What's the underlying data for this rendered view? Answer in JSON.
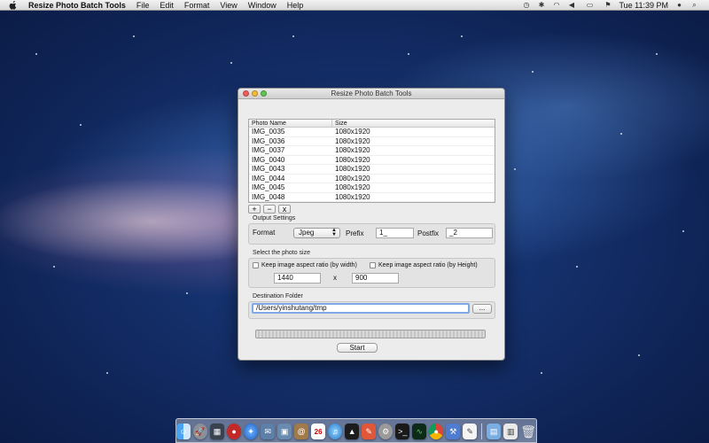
{
  "menubar": {
    "app_name": "Resize Photo Batch Tools",
    "items": [
      "File",
      "Edit",
      "Format",
      "View",
      "Window",
      "Help"
    ],
    "clock": "Tue 11:39 PM",
    "tray_icons": [
      "time-machine-icon",
      "bluetooth-icon",
      "wifi-icon",
      "volume-icon",
      "battery-icon",
      "flag-icon",
      "user-icon",
      "spotlight-icon"
    ]
  },
  "window": {
    "title": "Resize Photo Batch Tools",
    "table": {
      "columns": [
        "Photo Name",
        "Size"
      ],
      "rows": [
        [
          "IMG_0035",
          "1080x1920"
        ],
        [
          "IMG_0036",
          "1080x1920"
        ],
        [
          "IMG_0037",
          "1080x1920"
        ],
        [
          "IMG_0040",
          "1080x1920"
        ],
        [
          "IMG_0043",
          "1080x1920"
        ],
        [
          "IMG_0044",
          "1080x1920"
        ],
        [
          "IMG_0045",
          "1080x1920"
        ],
        [
          "IMG_0048",
          "1080x1920"
        ]
      ]
    },
    "table_buttons": {
      "add": "+",
      "remove": "−",
      "clear": "x"
    },
    "output_settings": {
      "label": "Output Settings",
      "format_label": "Format",
      "format_value": "Jpeg",
      "prefix_label": "Prefix",
      "prefix_value": "1_",
      "postfix_label": "Postfix",
      "postfix_value": "_2"
    },
    "photo_size": {
      "label": "Select the photo size",
      "by_width_label": "Keep image aspect ratio (by width)",
      "by_height_label": "Keep image aspect ratio (by Height)",
      "width_value": "1440",
      "times": "x",
      "height_value": "900"
    },
    "destination": {
      "label": "Destination Folder",
      "path": "/Users/yinshutang/tmp",
      "browse_label": "..."
    },
    "progress": 0,
    "start_label": "Start"
  },
  "dock": {
    "icons": [
      "finder-icon",
      "launchpad-icon",
      "mission-control-icon",
      "photo-booth-icon",
      "safari-icon",
      "mail-icon",
      "preview-icon",
      "contacts-icon",
      "calendar-icon",
      "itunes-icon",
      "iphoto-icon",
      "app-store-icon",
      "system-preferences-icon",
      "terminal-icon",
      "activity-monitor-icon",
      "chrome-icon",
      "xcode-icon",
      "textedit-icon",
      "applications-folder-icon",
      "documents-folder-icon",
      "trash-icon"
    ],
    "calendar_day": "26"
  }
}
